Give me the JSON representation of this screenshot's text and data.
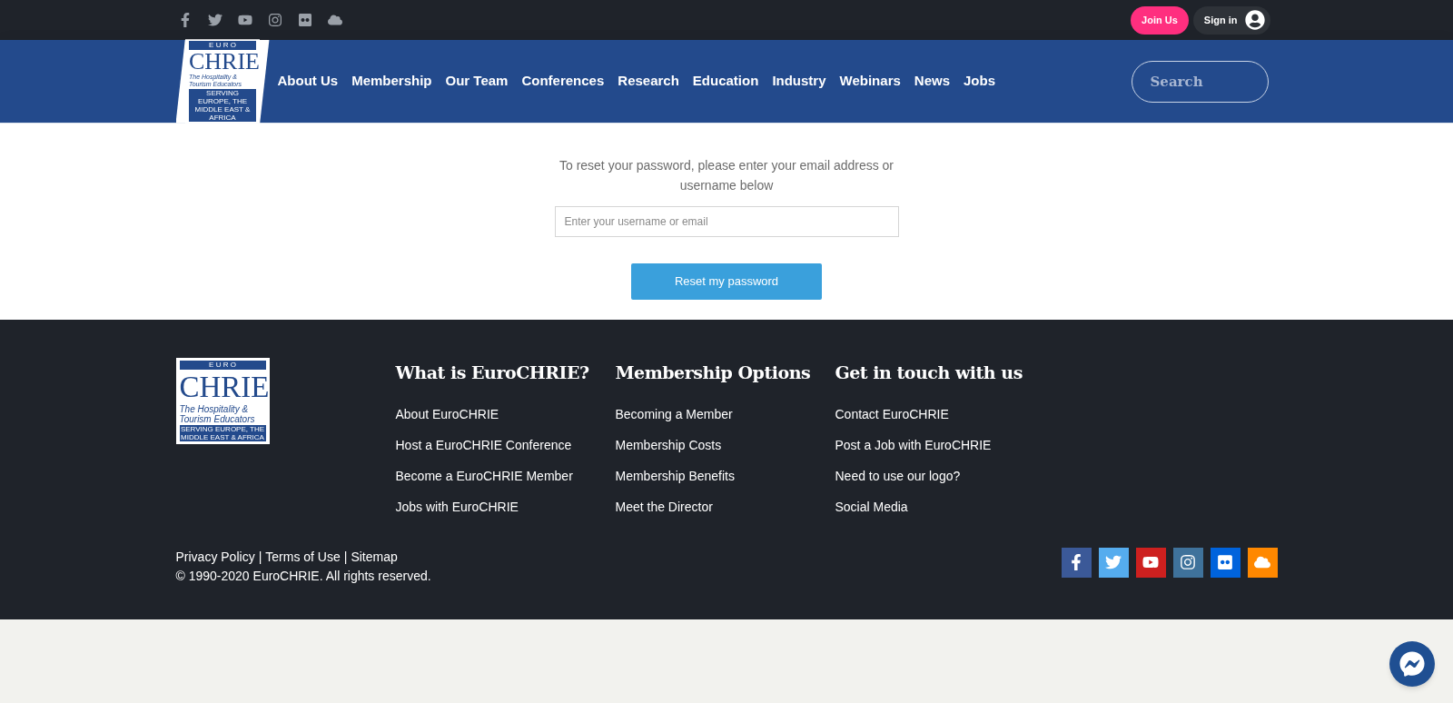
{
  "top_bar": {
    "social": [
      {
        "kind": "facebook"
      },
      {
        "kind": "twitter"
      },
      {
        "kind": "youtube"
      },
      {
        "kind": "instagram"
      },
      {
        "kind": "flickr"
      },
      {
        "kind": "soundcloud"
      }
    ],
    "join_button": "Join Us",
    "sign_in_button": "Sign in"
  },
  "header": {
    "logo": {
      "top": "E U R O",
      "main": "CHRIE",
      "tagline": "The Hospitality & Tourism Educators",
      "strap": "SERVING EUROPE, THE MIDDLE EAST & AFRICA"
    },
    "nav": [
      "About Us",
      "Membership",
      "Our Team",
      "Conferences",
      "Research",
      "Education",
      "Industry",
      "Webinars",
      "News",
      "Jobs"
    ],
    "search": {
      "placeholder": "Search"
    }
  },
  "reset": {
    "instruction": "To reset your password, please enter your email address or username below",
    "field": {
      "placeholder": "Enter your username or email"
    },
    "button": "Reset my password"
  },
  "footer": {
    "logo": {
      "top": "E U R O",
      "main": "CHRIE",
      "tagline": "The Hospitality & Tourism Educators",
      "strap": "SERVING EUROPE, THE MIDDLE EAST & AFRICA"
    },
    "columns": [
      {
        "heading": "What is EuroCHRIE?",
        "links": [
          "About EuroCHRIE",
          "Host a EuroCHRIE Conference",
          "Become a EuroCHRIE Member",
          "Jobs with EuroCHRIE"
        ]
      },
      {
        "heading": "Membership Options",
        "links": [
          "Becoming a Member",
          "Membership Costs",
          "Membership Benefits",
          "Meet the Director"
        ]
      },
      {
        "heading": "Get in touch with us",
        "links": [
          "Contact EuroCHRIE",
          "Post a Job with EuroCHRIE",
          "Need to use our logo?",
          "Social Media"
        ]
      }
    ],
    "legal_links": [
      "Privacy Policy",
      "Terms of Use",
      "Sitemap"
    ],
    "separator": "|",
    "copyright": "© 1990-2020 EuroCHRIE. All rights reserved.",
    "social": [
      {
        "kind": "facebook",
        "color": "#3b5998"
      },
      {
        "kind": "twitter",
        "color": "#55acee"
      },
      {
        "kind": "youtube",
        "color": "#cd201f"
      },
      {
        "kind": "instagram",
        "color": "#3f729b"
      },
      {
        "kind": "flickr",
        "color": "#0063dc"
      },
      {
        "kind": "soundcloud",
        "color": "#ff8800"
      }
    ]
  }
}
